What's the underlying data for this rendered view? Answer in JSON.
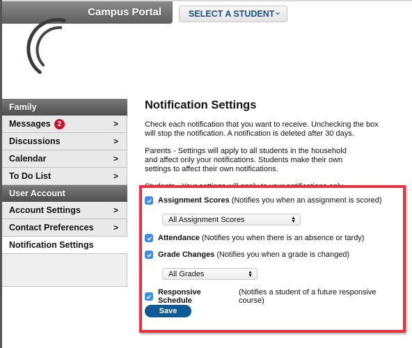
{
  "header": {
    "app_title": "Campus Portal",
    "student_select_label": "SELECT A STUDENT"
  },
  "sidebar": {
    "sections": [
      {
        "title": "Family",
        "items": [
          {
            "label": "Messages",
            "badge": "2"
          },
          {
            "label": "Discussions"
          },
          {
            "label": "Calendar"
          },
          {
            "label": "To Do List"
          }
        ]
      },
      {
        "title": "User Account",
        "items": [
          {
            "label": "Account Settings"
          },
          {
            "label": "Contact Preferences"
          },
          {
            "label": "Notification Settings",
            "active": true
          }
        ]
      }
    ],
    "chevron": ">"
  },
  "main": {
    "title": "Notification Settings",
    "paragraphs": [
      "Check each notification that you want to receive. Unchecking the box will stop the notification. A notification is deleted after 30 days.",
      "Parents - Settings will apply to all students in the household and affect only your notifications. Students make their own settings to affect their own notifications.",
      "Students - Your settings will apply to your notifications only."
    ],
    "options": [
      {
        "name": "Assignment Scores",
        "desc": "(Notifies you when an assignment is scored)",
        "checked": true,
        "select_value": "All Assignment Scores"
      },
      {
        "name": "Attendance",
        "desc": "(Notifies you when there is an absence or tardy)",
        "checked": true
      },
      {
        "name": "Grade Changes",
        "desc": "(Notifies you when a grade is changed)",
        "checked": true,
        "select_value": "All Grades"
      },
      {
        "name": "Responsive Schedule",
        "desc": "(Notifies a student of a future responsive course)",
        "checked": true
      }
    ],
    "save_label": "Save"
  },
  "colors": {
    "highlight_border": "#e8323f",
    "checkbox": "#3b8de8",
    "save_button": "#0f5a96",
    "badge": "#d0112b",
    "select_text": "#1a4f8c"
  }
}
